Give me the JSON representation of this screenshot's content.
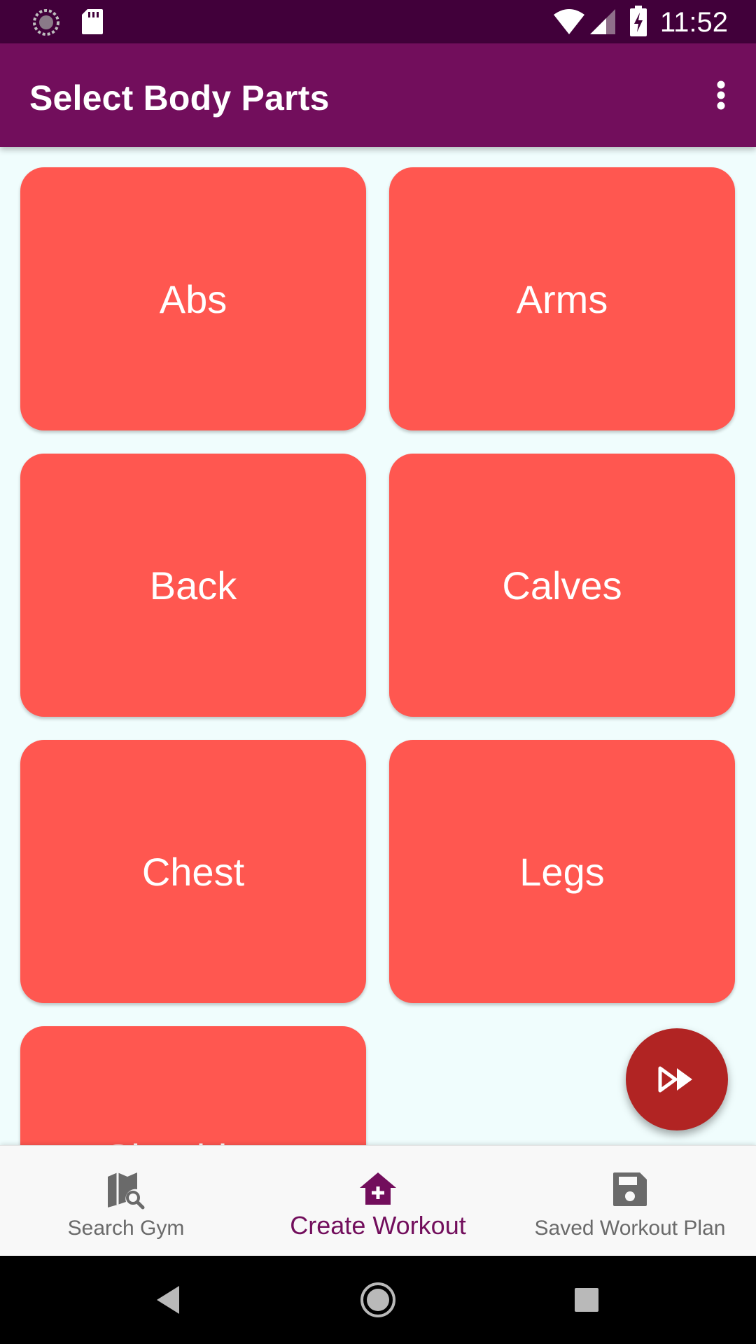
{
  "status_bar": {
    "time": "11:52",
    "left_icons": [
      "sync-icon",
      "sd-card-icon"
    ],
    "right_icons": [
      "wifi-icon",
      "signal-icon",
      "battery-charging-icon"
    ]
  },
  "app_bar": {
    "title": "Select Body Parts",
    "menu_icon": "more-vert-icon"
  },
  "body_parts": [
    {
      "label": "Abs"
    },
    {
      "label": "Arms"
    },
    {
      "label": "Back"
    },
    {
      "label": "Calves"
    },
    {
      "label": "Chest"
    },
    {
      "label": "Legs"
    },
    {
      "label": "Shoulders"
    }
  ],
  "fab": {
    "icon": "fast-forward-icon"
  },
  "bottom_nav": {
    "items": [
      {
        "label": "Search Gym",
        "icon": "map-search-icon",
        "active": false
      },
      {
        "label": "Create Workout",
        "icon": "home-plus-icon",
        "active": true
      },
      {
        "label": "Saved Workout Plan",
        "icon": "save-icon",
        "active": false
      }
    ]
  },
  "system_nav": {
    "buttons": [
      "back-icon",
      "home-icon",
      "recents-icon"
    ]
  },
  "colors": {
    "status_bar": "#41003a",
    "app_bar": "#720e5c",
    "tile": "#ff5750",
    "fab": "#b12423",
    "background": "#f0fdfd",
    "nav_active": "#720e5c",
    "nav_inactive": "#6a6a6a"
  }
}
